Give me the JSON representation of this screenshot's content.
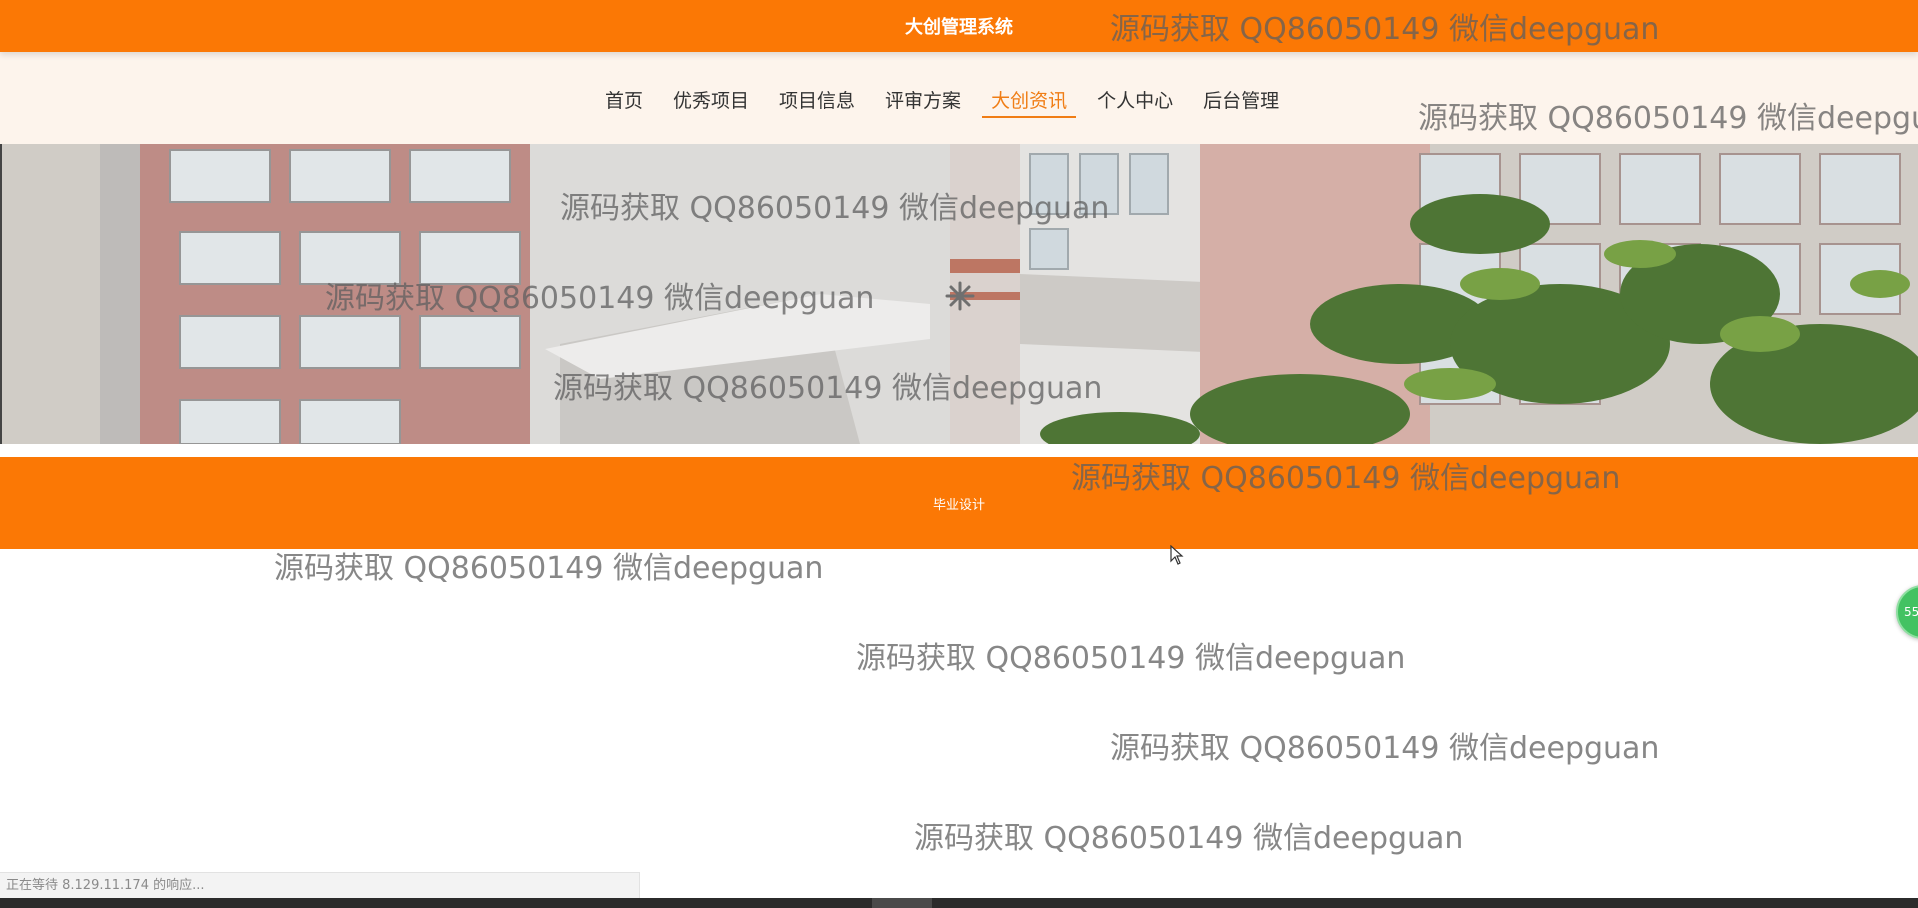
{
  "header": {
    "title": "大创管理系统"
  },
  "nav": {
    "items": [
      "首页",
      "优秀项目",
      "项目信息",
      "评审方案",
      "大创资讯",
      "个人中心",
      "后台管理"
    ],
    "active": "大创资讯"
  },
  "banner": {
    "loading_icon": "asterisk-spinner-icon",
    "image": "campus-building-photo"
  },
  "section": {
    "label": "毕业设计"
  },
  "watermark_text": "源码获取 QQ86050149 微信deepguan",
  "float_widget": {
    "label": "55",
    "icon": "float-badge-icon"
  },
  "statusbar": {
    "text": "正在等待 8.129.11.174 的响应..."
  },
  "colors": {
    "primary": "#fb7805",
    "nav_bg": "#fdf4ec",
    "active_nav": "#f07d15",
    "badge": "#43c262"
  }
}
